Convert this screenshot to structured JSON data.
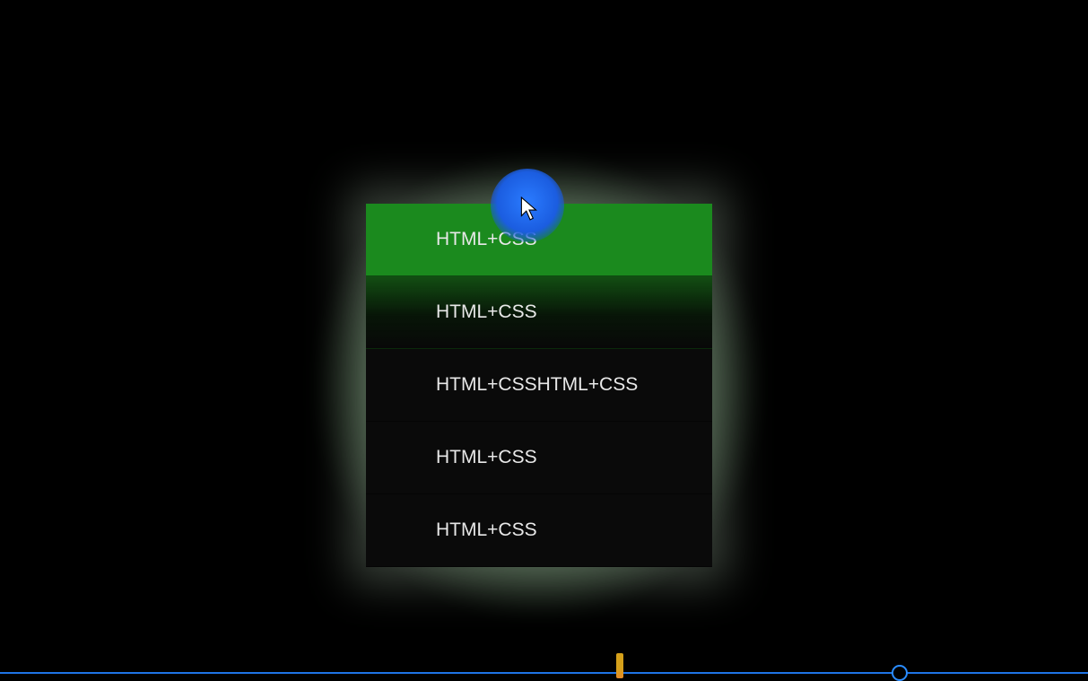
{
  "menu": {
    "items": [
      {
        "label": "HTML+CSS",
        "state": "active"
      },
      {
        "label": "HTML+CSS",
        "state": "second"
      },
      {
        "label": "HTML+CSSHTML+CSS",
        "state": "normal"
      },
      {
        "label": "HTML+CSS",
        "state": "normal"
      },
      {
        "label": "HTML+CSS",
        "state": "normal"
      }
    ]
  },
  "cursor": {
    "highlight_color": "#1c5fe0"
  },
  "timeline": {
    "bar_color": "#1e74e6",
    "marker_color": "#d5a01a"
  }
}
